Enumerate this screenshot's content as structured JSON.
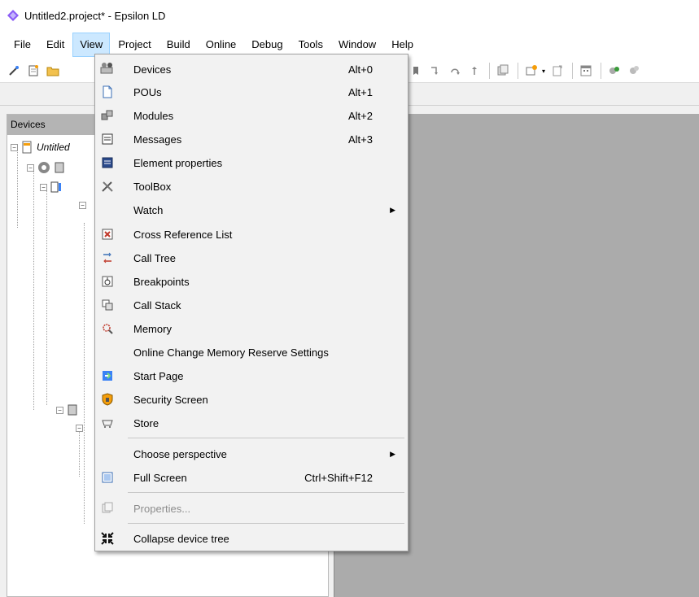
{
  "window": {
    "title": "Untitled2.project* - Epsilon LD"
  },
  "menubar": {
    "items": [
      {
        "label": "File",
        "active": false
      },
      {
        "label": "Edit",
        "active": false
      },
      {
        "label": "View",
        "active": true
      },
      {
        "label": "Project",
        "active": false
      },
      {
        "label": "Build",
        "active": false
      },
      {
        "label": "Online",
        "active": false
      },
      {
        "label": "Debug",
        "active": false
      },
      {
        "label": "Tools",
        "active": false
      },
      {
        "label": "Window",
        "active": false
      },
      {
        "label": "Help",
        "active": false
      }
    ]
  },
  "devices_panel": {
    "title": "Devices",
    "root_label": "Untitled"
  },
  "view_menu": {
    "items": [
      {
        "label": "Devices",
        "shortcut": "Alt+0",
        "icon": "devices-icon"
      },
      {
        "label": "POUs",
        "shortcut": "Alt+1",
        "icon": "pous-icon"
      },
      {
        "label": "Modules",
        "shortcut": "Alt+2",
        "icon": "modules-icon"
      },
      {
        "label": "Messages",
        "shortcut": "Alt+3",
        "icon": "messages-icon"
      },
      {
        "label": "Element properties",
        "icon": "element-properties-icon"
      },
      {
        "label": "ToolBox",
        "icon": "toolbox-icon"
      },
      {
        "label": "Watch",
        "submenu": true
      },
      {
        "label": "Cross Reference List",
        "icon": "cross-reference-icon"
      },
      {
        "label": "Call Tree",
        "icon": "call-tree-icon"
      },
      {
        "label": "Breakpoints",
        "icon": "breakpoints-icon"
      },
      {
        "label": "Call Stack",
        "icon": "call-stack-icon"
      },
      {
        "label": "Memory",
        "icon": "memory-icon"
      },
      {
        "label": "Online Change Memory Reserve Settings"
      },
      {
        "label": "Start Page",
        "icon": "start-page-icon"
      },
      {
        "label": "Security Screen",
        "icon": "security-screen-icon"
      },
      {
        "label": "Store",
        "icon": "store-icon"
      },
      {
        "label": "Choose perspective",
        "submenu": true
      },
      {
        "label": "Full Screen",
        "shortcut": "Ctrl+Shift+F12",
        "icon": "full-screen-icon"
      },
      {
        "label": "Properties...",
        "disabled": true,
        "icon": "properties-icon"
      },
      {
        "label": "Collapse device tree",
        "icon": "collapse-tree-icon"
      }
    ]
  },
  "colors": {
    "menu_highlight": "#cce8ff",
    "panel_header": "#b4b4b4",
    "editor_background": "#ababab"
  }
}
